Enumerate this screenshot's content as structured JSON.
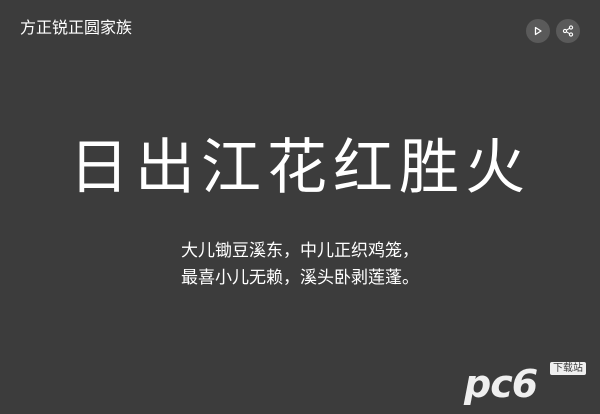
{
  "header": {
    "title": "方正锐正圆家族"
  },
  "controls": {
    "play_icon": "play-icon",
    "share_icon": "share-icon"
  },
  "content": {
    "headline": "日出江花红胜火",
    "poem_lines": [
      "大儿锄豆溪东，中儿正织鸡笼，",
      "最喜小儿无赖，溪头卧剥莲蓬。"
    ]
  },
  "watermark": {
    "logo_text": "pc6",
    "badge_text": "下载站"
  },
  "colors": {
    "background": "#3c3c3c",
    "button_bg": "#5a5a5a",
    "text": "#ffffff"
  }
}
